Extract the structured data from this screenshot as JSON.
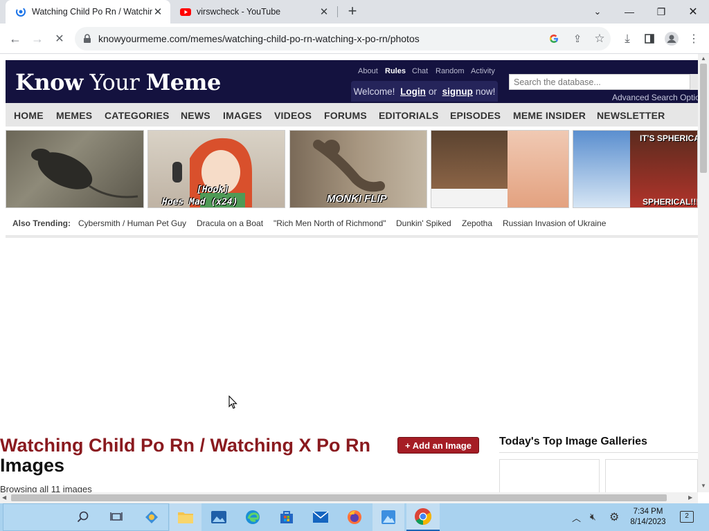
{
  "browser": {
    "tabs": [
      {
        "title": "Watching Child Po Rn / Watching X Po Rn | Know Your Meme",
        "active": true
      },
      {
        "title": "virswcheck - YouTube",
        "active": false
      }
    ],
    "url": "knowyourmeme.com/memes/watching-child-po-rn-watching-x-po-rn/photos"
  },
  "site": {
    "logo": {
      "part1": "Know",
      "part2": " Your ",
      "part3": "Meme"
    },
    "top_links": [
      "About",
      "Rules",
      "Chat",
      "Random",
      "Activity"
    ],
    "welcome": {
      "prefix": "Welcome!",
      "login": "Login",
      "or": "or",
      "signup": "signup",
      "suffix": "now!"
    },
    "search_placeholder": "Search the database...",
    "advanced_search": "Advanced Search Options",
    "nav": [
      "HOME",
      "MEMES",
      "CATEGORIES",
      "NEWS",
      "IMAGES",
      "VIDEOS",
      "FORUMS",
      "EDITORIALS",
      "EPISODES",
      "MEME INSIDER",
      "NEWSLETTER"
    ],
    "thumb_captions": {
      "hook": "[Hook]",
      "hoes": "Hoes Mad (x24)",
      "monki": "MONKI FLIP",
      "spherical_top": "IT'S SPHERICAL",
      "spherical_bottom": "SPHERICAL!!!"
    },
    "also_trending_label": "Also Trending:",
    "trending": [
      "Cybersmith / Human Pet Guy",
      "Dracula on a Boat",
      "\"Rich Men North of Richmond\"",
      "Dunkin' Spiked",
      "Zepotha",
      "Russian Invasion of Ukraine"
    ],
    "title_red": "Watching Child Po Rn / Watching X Po Rn",
    "title_dark": "Images",
    "add_image": "+ Add an Image",
    "browsing": "Browsing all 11 images",
    "galleries_heading": "Today's Top Image Galleries"
  },
  "taskbar": {
    "time": "7:34 PM",
    "date": "8/14/2023",
    "notifications": "2"
  }
}
